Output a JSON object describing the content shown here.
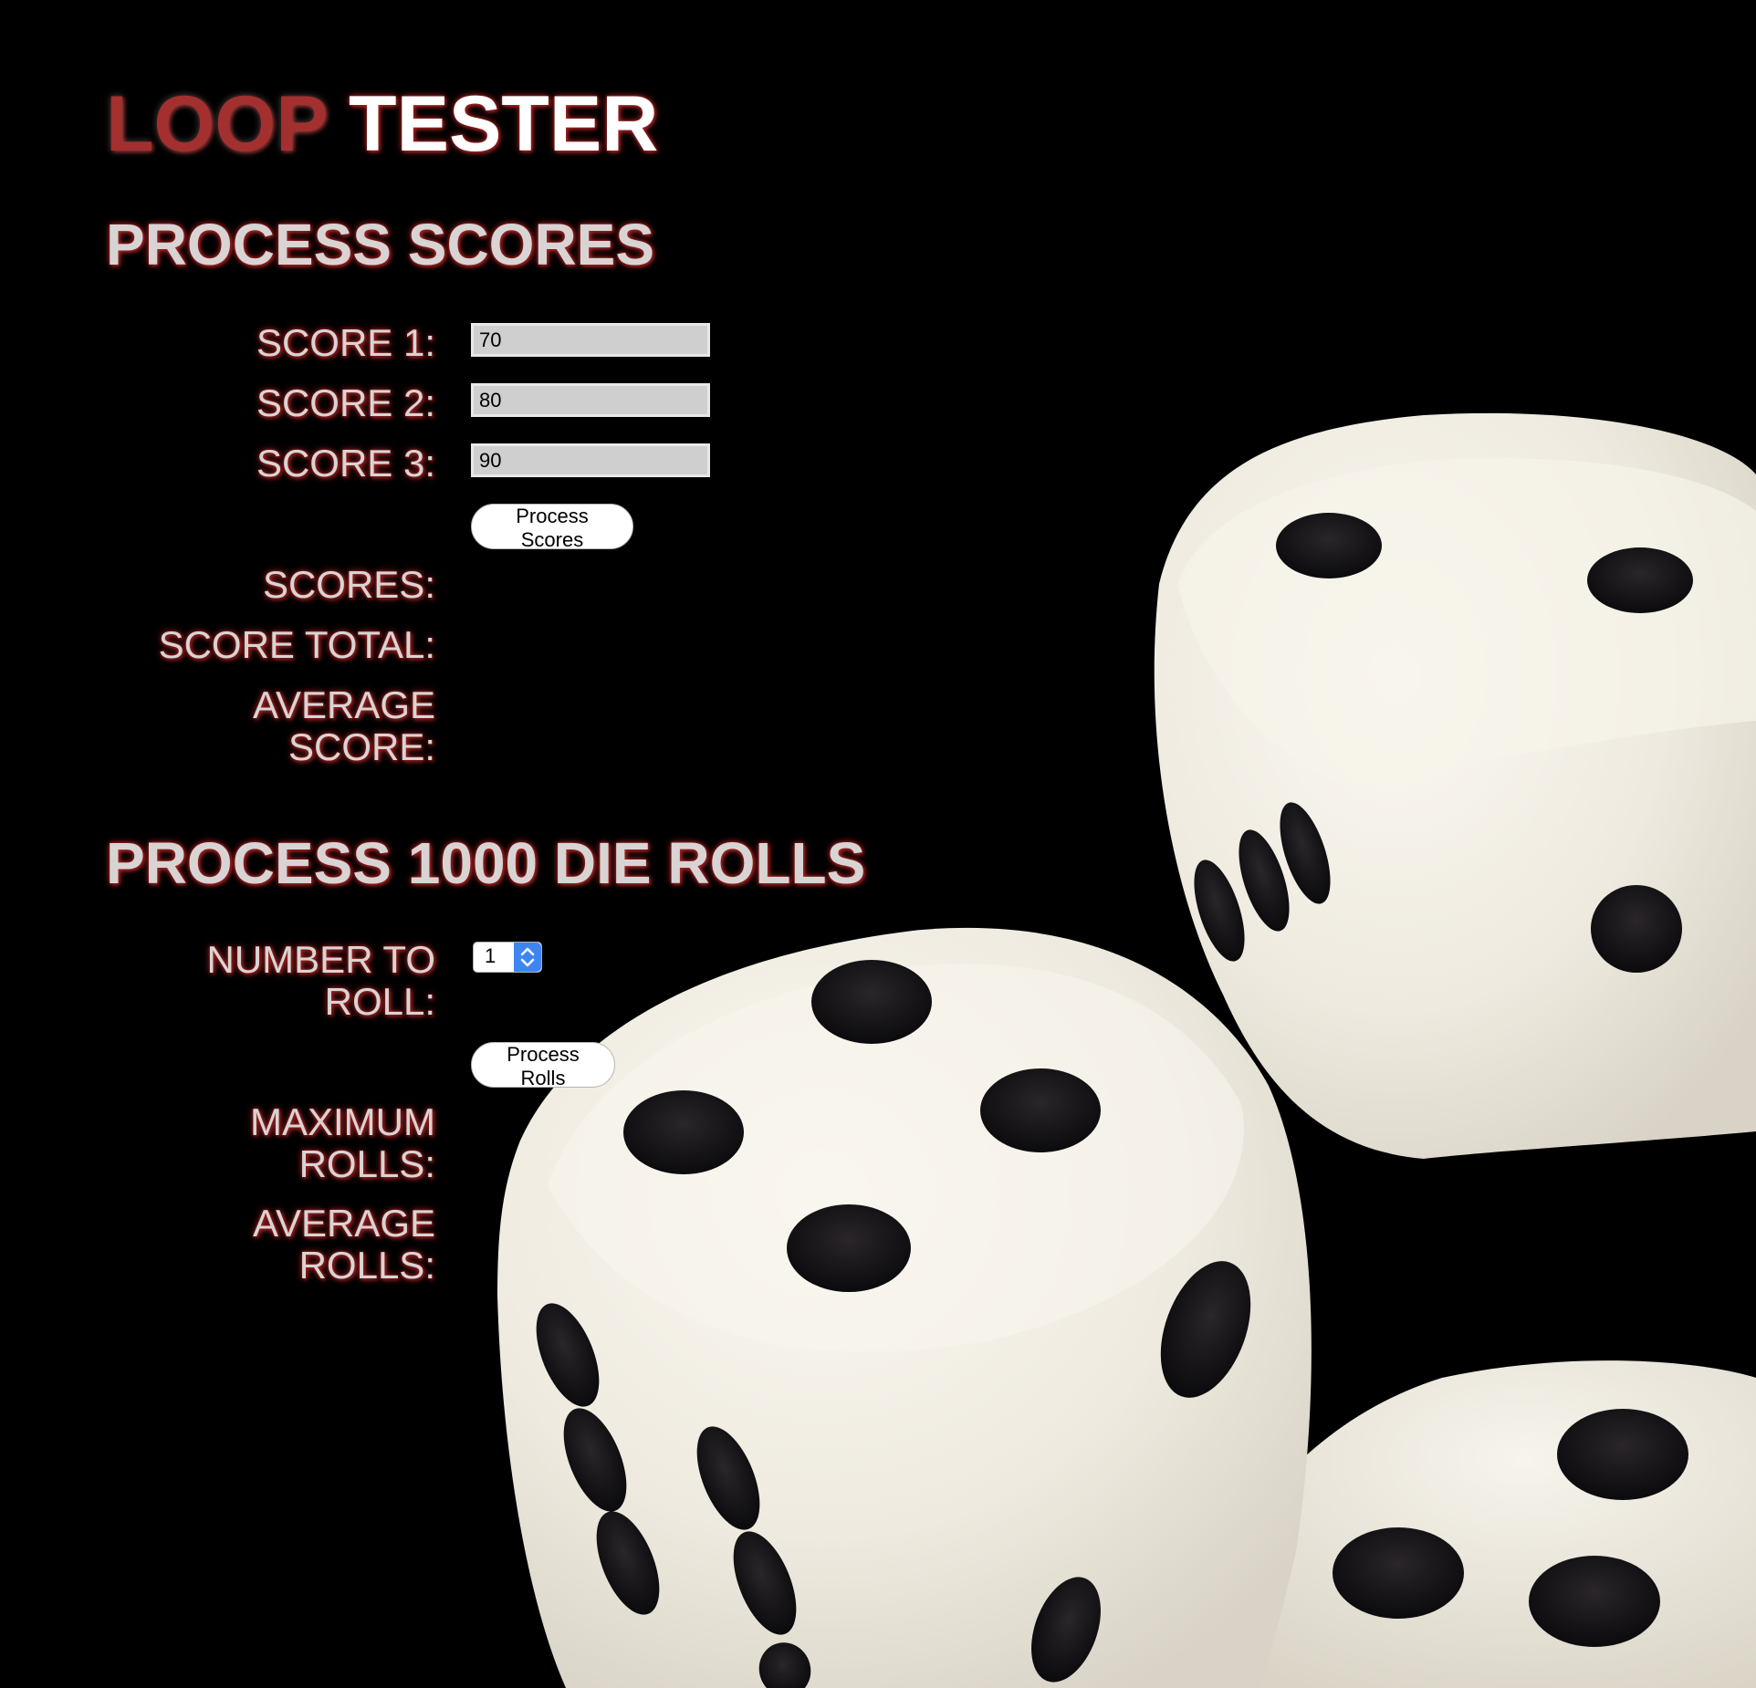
{
  "header": {
    "title_part1": "LOOP",
    "title_part2": "TESTER"
  },
  "scores_section": {
    "title": "PROCESS SCORES",
    "score1_label": "SCORE 1:",
    "score1_value": "70",
    "score2_label": "SCORE 2:",
    "score2_value": "80",
    "score3_label": "SCORE 3:",
    "score3_value": "90",
    "process_button": "Process Scores",
    "scores_label": "SCORES:",
    "total_label": "SCORE TOTAL:",
    "average_label_line1": "AVERAGE",
    "average_label_line2": "SCORE:"
  },
  "rolls_section": {
    "title": "PROCESS 1000 DIE ROLLS",
    "number_label_line1": "NUMBER TO",
    "number_label_line2": "ROLL:",
    "number_selected": "1",
    "process_button": "Process Rolls",
    "max_label_line1": "MAXIMUM",
    "max_label_line2": "ROLLS:",
    "avg_label_line1": "AVERAGE",
    "avg_label_line2": "ROLLS:"
  },
  "colors": {
    "title_accent": "#a3302f",
    "text": "#d9d4d4",
    "select_accent": "#3d86f2"
  }
}
